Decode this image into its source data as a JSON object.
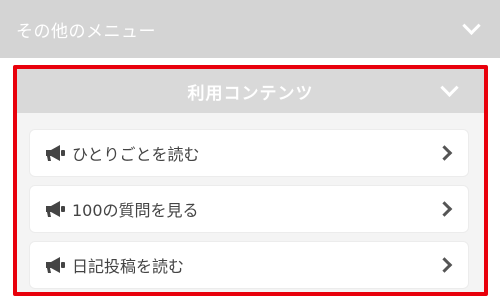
{
  "other_menu": {
    "title": "その他のメニュー"
  },
  "content_panel": {
    "title": "利用コンテンツ",
    "items": [
      {
        "label": "ひとりごとを読む",
        "icon": "megaphone-icon"
      },
      {
        "label": "100の質問を見る",
        "icon": "megaphone-icon"
      },
      {
        "label": "日記投稿を読む",
        "icon": "megaphone-icon"
      }
    ]
  },
  "colors": {
    "highlight": "#e8000b",
    "header_bg": "#d9d9d9",
    "text": "#444444"
  }
}
